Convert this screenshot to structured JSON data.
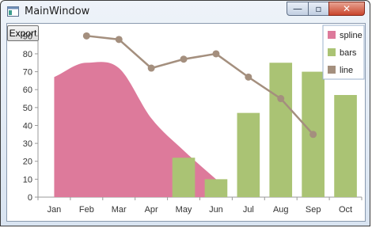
{
  "window": {
    "title": "MainWindow",
    "controls": {
      "minimize": "—",
      "maximize": "▫",
      "close": "✕"
    }
  },
  "toolbar": {
    "export_label": "Export"
  },
  "colors": {
    "spline": "#dd7a9b",
    "bars": "#aac374",
    "line": "#a48f7e"
  },
  "chart_data": {
    "type": "bar",
    "categories": [
      "Jan",
      "Feb",
      "Mar",
      "Apr",
      "May",
      "Jun",
      "Jul",
      "Aug",
      "Sep",
      "Oct"
    ],
    "ylim": [
      0,
      95
    ],
    "yticks": [
      0,
      10,
      20,
      30,
      40,
      50,
      60,
      70,
      80,
      90
    ],
    "legend": [
      "spline",
      "bars",
      "line"
    ],
    "legend_position": "top-right",
    "series": [
      {
        "name": "spline",
        "type": "area",
        "values": [
          67,
          75,
          72,
          44,
          26,
          10,
          null,
          null,
          null,
          null
        ]
      },
      {
        "name": "bars",
        "type": "bar",
        "values": [
          null,
          null,
          null,
          null,
          22,
          10,
          47,
          75,
          70,
          57
        ]
      },
      {
        "name": "line",
        "type": "line",
        "values": [
          null,
          90,
          88,
          72,
          77,
          80,
          67,
          55,
          35,
          null
        ]
      }
    ]
  }
}
